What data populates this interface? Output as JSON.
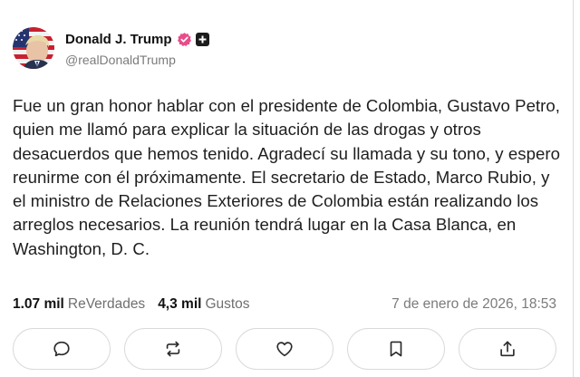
{
  "author": {
    "display_name": "Donald J. Trump",
    "handle": "@realDonaldTrump",
    "avatar_icon": "avatar-flag-portrait",
    "verified_color": "#e84d8a"
  },
  "post": {
    "text": "Fue un gran honor hablar con el presidente de Colombia, Gustavo Petro, quien me llamó para explicar la situación de las drogas y otros desacuerdos que hemos tenido. Agradecí su llamada y su tono, y espero reunirme con él próximamente. El secretario de Estado, Marco Rubio, y el ministro de Relaciones Exteriores de Colombia están realizando los arreglos necesarios. La reunión tendrá lugar en la Casa Blanca, en Washington, D. C."
  },
  "stats": {
    "reposts_value": "1.07 mil",
    "reposts_label": "ReVerdades",
    "likes_value": "4,3 mil",
    "likes_label": "Gustos",
    "timestamp": "7 de enero de 2026, 18:53"
  },
  "actions": [
    {
      "icon": "reply-icon"
    },
    {
      "icon": "repost-icon"
    },
    {
      "icon": "like-icon"
    },
    {
      "icon": "bookmark-icon"
    },
    {
      "icon": "share-icon"
    }
  ]
}
